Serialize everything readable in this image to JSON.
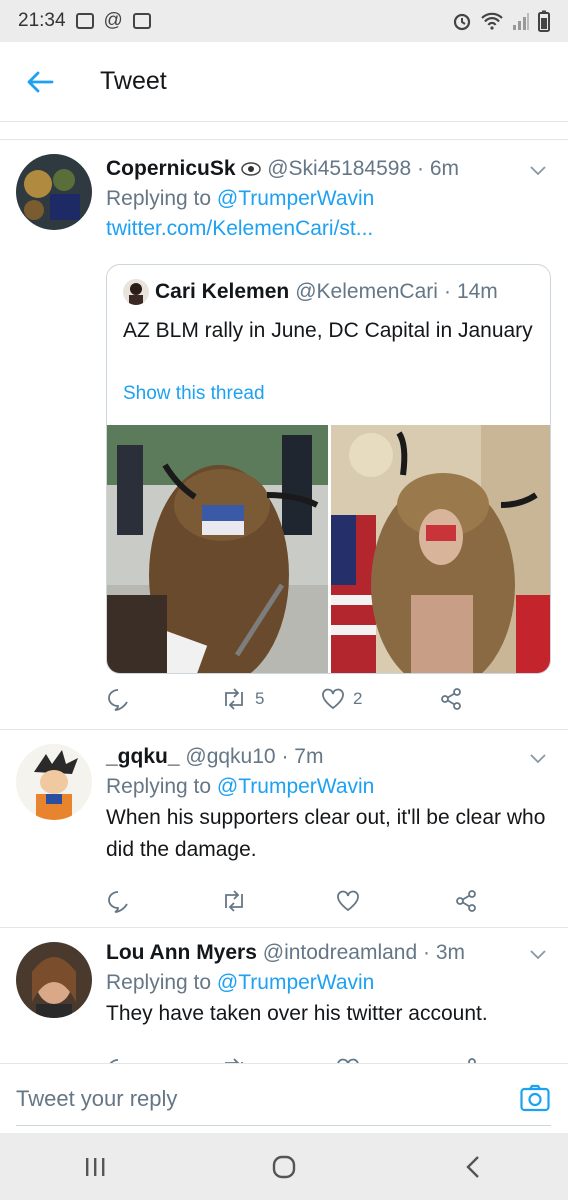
{
  "status_bar": {
    "time": "21:34",
    "at_symbol": "@",
    "battery_icon": "battery-icon",
    "wifi_icon": "wifi-icon",
    "alarm_icon": "alarm-icon"
  },
  "header": {
    "title": "Tweet",
    "back_icon": "arrow-left-icon"
  },
  "tweets": [
    {
      "name": "CopernicuSk",
      "handle": "@Ski45184598",
      "sep": "·",
      "time": "6m",
      "replying_prefix": "Replying to",
      "replying_to": "@TrumperWavin",
      "link": "twitter.com/KelemenCari/st...",
      "quote": {
        "name": "Cari Kelemen",
        "handle": "@KelemenCari",
        "sep": "·",
        "time": "14m",
        "text": "AZ BLM rally in June, DC Capital in January",
        "show_thread": "Show this thread"
      },
      "retweets": "5",
      "likes": "2"
    },
    {
      "name": "_gqku_",
      "handle": "@gqku10",
      "sep": "·",
      "time": "7m",
      "replying_prefix": "Replying to",
      "replying_to": "@TrumperWavin",
      "text": "When his supporters clear out, it'll be clear who did the damage."
    },
    {
      "name": "Lou Ann Myers",
      "handle": "@intodreamland",
      "sep": "·",
      "time": "3m",
      "replying_prefix": "Replying to",
      "replying_to": "@TrumperWavin",
      "text": "They have taken over his twitter account."
    }
  ],
  "reply_bar": {
    "placeholder": "Tweet your reply",
    "camera_icon": "camera-icon"
  },
  "nav_bar": {
    "recents_icon": "recents-icon",
    "home_icon": "home-icon",
    "back_icon": "back-icon"
  },
  "colors": {
    "accent": "#1da1f2",
    "secondary_text": "#657786",
    "border": "#e1e8ed"
  }
}
